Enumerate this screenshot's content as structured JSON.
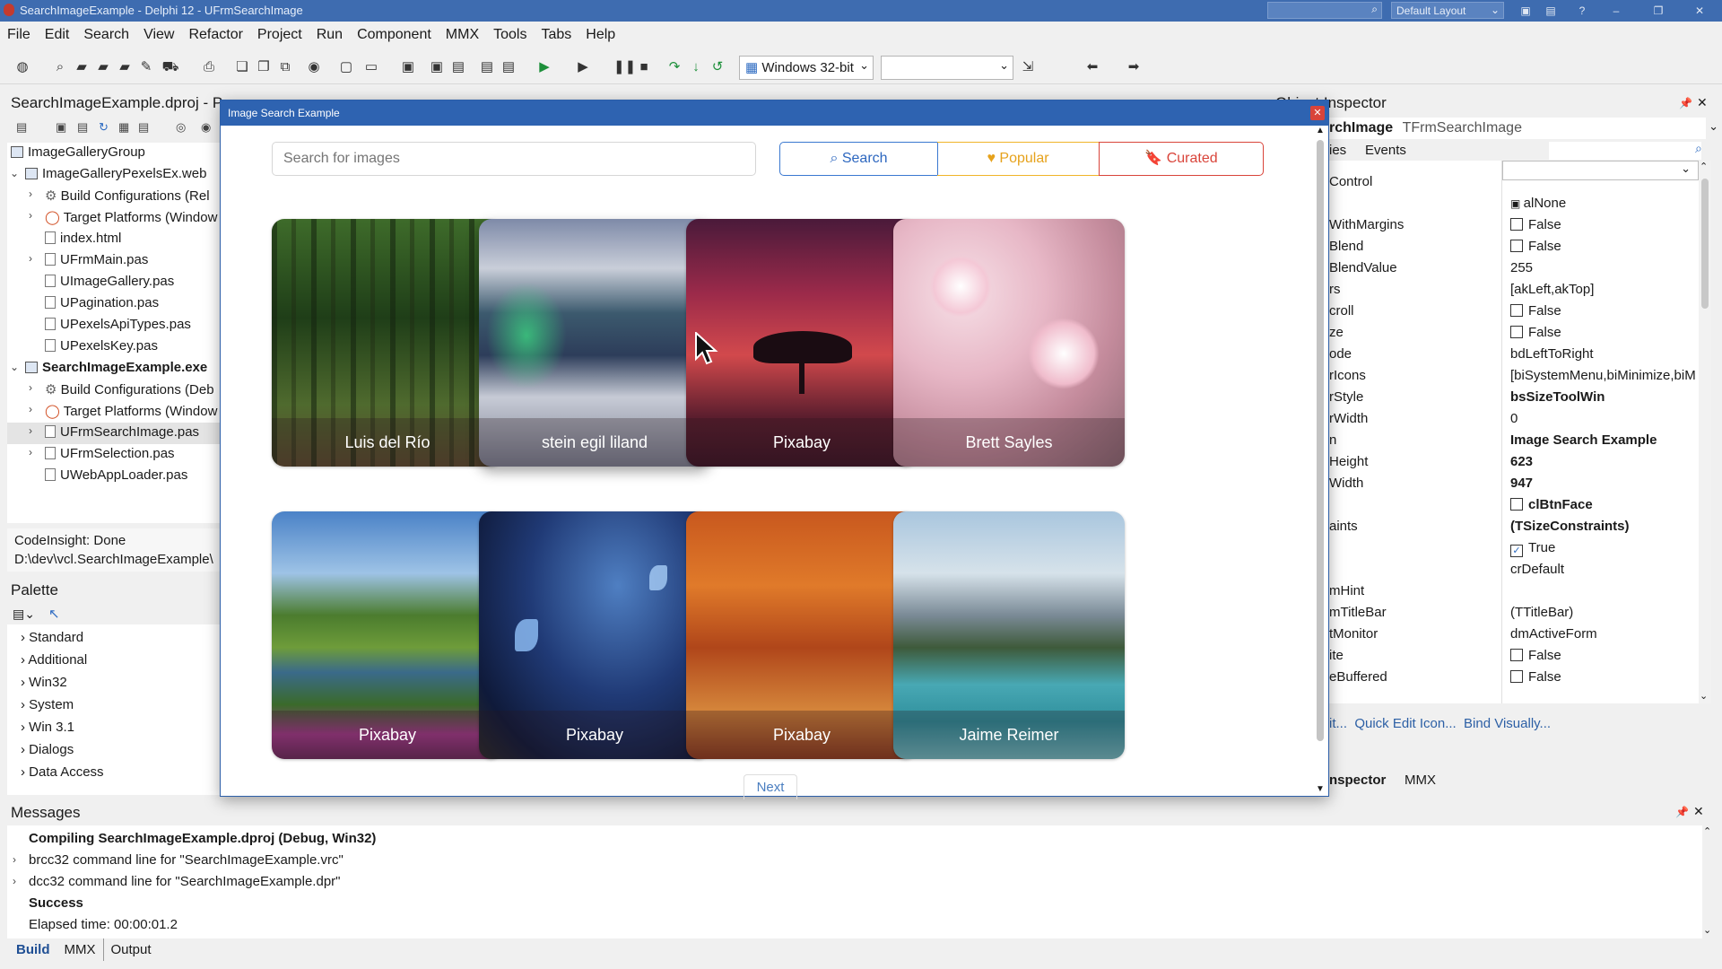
{
  "window": {
    "title": "SearchImageExample - Delphi 12 - UFrmSearchImage",
    "layout": "Default Layout"
  },
  "menu": [
    "File",
    "Edit",
    "Search",
    "View",
    "Refactor",
    "Project",
    "Run",
    "Component",
    "MMX",
    "Tools",
    "Tabs",
    "Help"
  ],
  "toolbar": {
    "platform": "Windows 32-bit",
    "config": ""
  },
  "project_panel": {
    "title": "SearchImageExample.dproj - Pr",
    "items": [
      {
        "label": "ImageGalleryGroup"
      },
      {
        "label": "ImageGalleryPexelsEx.web"
      },
      {
        "label": "Build Configurations (Rel"
      },
      {
        "label": "Target Platforms (Window"
      },
      {
        "label": "index.html"
      },
      {
        "label": "UFrmMain.pas"
      },
      {
        "label": "UImageGallery.pas"
      },
      {
        "label": "UPagination.pas"
      },
      {
        "label": "UPexelsApiTypes.pas"
      },
      {
        "label": "UPexelsKey.pas"
      },
      {
        "label": "SearchImageExample.exe"
      },
      {
        "label": "Build Configurations (Deb"
      },
      {
        "label": "Target Platforms (Window"
      },
      {
        "label": "UFrmSearchImage.pas"
      },
      {
        "label": "UFrmSelection.pas"
      },
      {
        "label": "UWebAppLoader.pas"
      }
    ],
    "status1": "CodeInsight: Done",
    "status2": "D:\\dev\\vcl.SearchImageExample\\"
  },
  "palette": {
    "title": "Palette",
    "items": [
      "Standard",
      "Additional",
      "Win32",
      "System",
      "Win 3.1",
      "Dialogs",
      "Data Access"
    ]
  },
  "dialog": {
    "title": "Image Search Example",
    "search_placeholder": "Search for images",
    "buttons": {
      "search": "Search",
      "popular": "Popular",
      "curated": "Curated"
    },
    "cards": [
      {
        "caption": "Luis del Río"
      },
      {
        "caption": "stein egil liland"
      },
      {
        "caption": "Pixabay"
      },
      {
        "caption": "Brett Sayles"
      },
      {
        "caption": "Pixabay"
      },
      {
        "caption": "Pixabay"
      },
      {
        "caption": "Pixabay"
      },
      {
        "caption": "Jaime Reimer"
      }
    ],
    "next": "Next"
  },
  "inspector": {
    "title": "Object Inspector",
    "object_name": "rchImage",
    "object_type": "TFrmSearchImage",
    "tabs": {
      "props": "ies",
      "events": "Events"
    },
    "rows": [
      {
        "name": "Control",
        "value": ""
      },
      {
        "name": "",
        "value": "alNone"
      },
      {
        "name": "WithMargins",
        "value": "False"
      },
      {
        "name": "Blend",
        "value": "False"
      },
      {
        "name": "BlendValue",
        "value": "255"
      },
      {
        "name": "rs",
        "value": "[akLeft,akTop]"
      },
      {
        "name": "croll",
        "value": "False"
      },
      {
        "name": "ze",
        "value": "False"
      },
      {
        "name": "ode",
        "value": "bdLeftToRight"
      },
      {
        "name": "rIcons",
        "value": "[biSystemMenu,biMinimize,biM"
      },
      {
        "name": "rStyle",
        "value": "bsSizeToolWin"
      },
      {
        "name": "rWidth",
        "value": "0"
      },
      {
        "name": "n",
        "value": "Image Search Example"
      },
      {
        "name": "Height",
        "value": "623"
      },
      {
        "name": "Width",
        "value": "947"
      },
      {
        "name": "",
        "value": "clBtnFace"
      },
      {
        "name": "aints",
        "value": "(TSizeConstraints)"
      },
      {
        "name": "",
        "value": "True"
      },
      {
        "name": "",
        "value": "crDefault"
      },
      {
        "name": "mHint",
        "value": ""
      },
      {
        "name": "mTitleBar",
        "value": "(TTitleBar)"
      },
      {
        "name": "tMonitor",
        "value": "dmActiveForm"
      },
      {
        "name": "ite",
        "value": "False"
      },
      {
        "name": "eBuffered",
        "value": "False"
      }
    ],
    "links": "it...  Quick Edit Icon...  Bind Visually...",
    "bottom_tabs": {
      "a": "nspector",
      "b": "MMX"
    }
  },
  "messages": {
    "title": "Messages",
    "lines": [
      "Compiling SearchImageExample.dproj (Debug, Win32)",
      "brcc32 command line for \"SearchImageExample.vrc\"",
      "dcc32 command line for \"SearchImageExample.dpr\"",
      "Success",
      "Elapsed time: 00:00:01.2"
    ],
    "tabs": [
      "Build",
      "MMX",
      "Output"
    ]
  },
  "colors": {
    "accent": "#2e63b1",
    "search_btn": "#3a78d0",
    "popular_btn": "#f0b429",
    "curated_btn": "#d9443a"
  }
}
